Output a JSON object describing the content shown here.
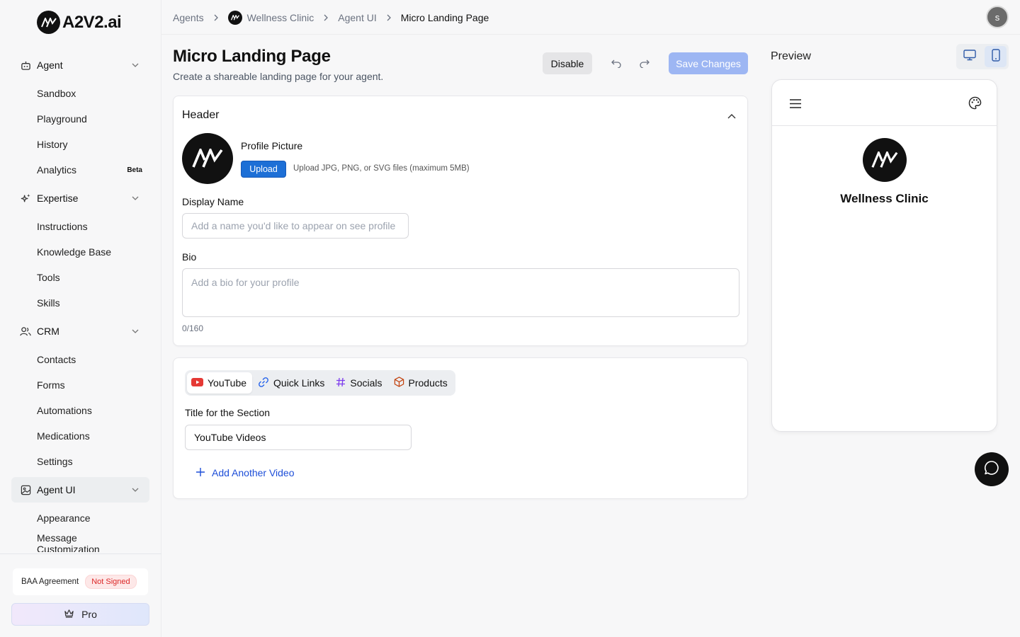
{
  "brand": {
    "name": "A2V2.ai"
  },
  "sidebar": {
    "groups": [
      {
        "label": "Agent",
        "icon": "robot-icon",
        "items": [
          {
            "label": "Sandbox",
            "badge": ""
          },
          {
            "label": "Playground",
            "badge": ""
          },
          {
            "label": "History",
            "badge": ""
          },
          {
            "label": "Analytics",
            "badge": "Beta"
          }
        ]
      },
      {
        "label": "Expertise",
        "icon": "sparkles-icon",
        "items": [
          {
            "label": "Instructions"
          },
          {
            "label": "Knowledge Base"
          },
          {
            "label": "Tools"
          },
          {
            "label": "Skills"
          }
        ]
      },
      {
        "label": "CRM",
        "icon": "users-icon",
        "items": [
          {
            "label": "Contacts"
          },
          {
            "label": "Forms"
          },
          {
            "label": "Automations"
          },
          {
            "label": "Medications"
          },
          {
            "label": "Settings"
          }
        ]
      },
      {
        "label": "Agent UI",
        "icon": "image-icon",
        "items": [
          {
            "label": "Appearance"
          },
          {
            "label": "Message Customization"
          }
        ]
      }
    ],
    "baa": {
      "label": "BAA Agreement",
      "status": "Not Signed"
    },
    "pro": {
      "label": "Pro"
    }
  },
  "breadcrumb": [
    "Agents",
    "Wellness Clinic",
    "Agent UI",
    "Micro Landing Page"
  ],
  "user": {
    "initial": "s"
  },
  "page": {
    "title": "Micro Landing Page",
    "subtitle": "Create a shareable landing page for your agent.",
    "disable_label": "Disable",
    "save_label": "Save Changes"
  },
  "header_card": {
    "title": "Header",
    "profile_picture_label": "Profile Picture",
    "upload_label": "Upload",
    "upload_hint": "Upload JPG, PNG, or SVG files (maximum 5MB)",
    "display_name_label": "Display Name",
    "display_name_placeholder": "Add a name you'd like to appear on see profile",
    "bio_label": "Bio",
    "bio_placeholder": "Add a bio for your profile",
    "bio_counter": "0/160"
  },
  "section_card": {
    "tabs": [
      {
        "label": "YouTube",
        "icon": "youtube-icon"
      },
      {
        "label": "Quick Links",
        "icon": "link-icon"
      },
      {
        "label": "Socials",
        "icon": "hashtag-icon"
      },
      {
        "label": "Products",
        "icon": "box-icon"
      }
    ],
    "title_label": "Title for the Section",
    "title_value": "YouTube Videos",
    "add_video_label": "Add Another Video"
  },
  "preview": {
    "label": "Preview",
    "display_name": "Wellness Clinic"
  },
  "colors": {
    "accent": "#1d6fd6",
    "save_disabled": "#9db6f3",
    "youtube_red": "#e53935",
    "link_blue": "#2563eb",
    "hashtag_purple": "#7c3aed",
    "box_orange": "#c2410c",
    "not_signed_red": "#dc2626"
  }
}
